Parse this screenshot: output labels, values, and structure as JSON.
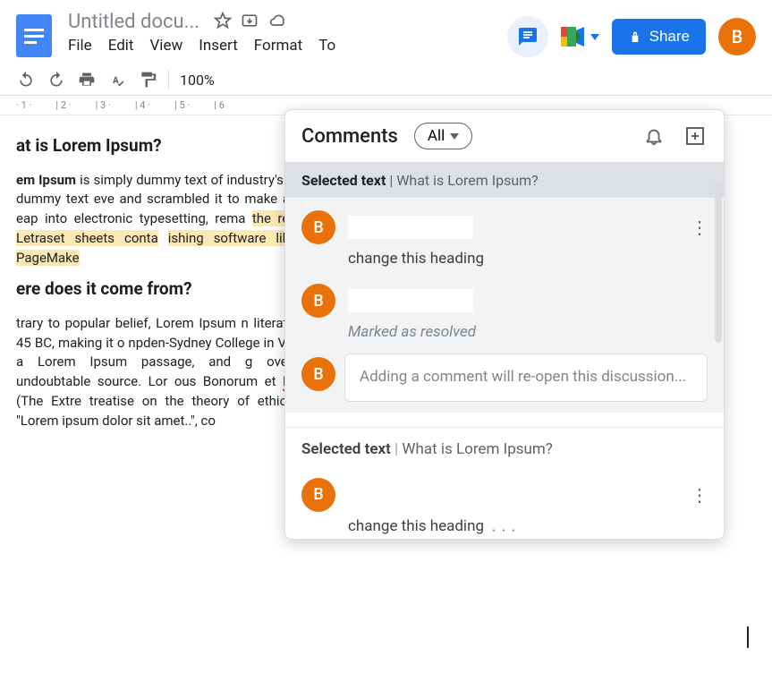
{
  "header": {
    "title": "Untitled docu...",
    "menus": [
      "File",
      "Edit",
      "View",
      "Insert",
      "Format",
      "To"
    ],
    "share_label": "Share",
    "avatar_initial": "B"
  },
  "toolbar": {
    "zoom": "100%"
  },
  "ruler": [
    "1",
    "2",
    "3",
    "4",
    "5",
    "6"
  ],
  "document": {
    "heading1": "at is Lorem Ipsum?",
    "p1_frag1": "em Ipsum",
    "p1_frag2": " is simply dummy text of industry's standard dummy text eve and scrambled it to make a type sp eap into electronic typesetting, rema ",
    "p1_hl1": "the release of Letraset sheets conta",
    "p1_hl2": "ishing software like Aldus PageMake",
    "heading2": "ere does it come from?",
    "p2_a": "trary to popular belief, Lorem Ipsum n literature from 45 BC, making it o npden-Sydney College in Virginia, lo  a Lorem Ipsum passage, and g overed the undoubtable source. Lor ous Bonorum et ",
    "p2_wavy": "Malorum",
    "p2_b": "\" (The Extre treatise on the theory of ethics, ve m, \"Lorem ipsum dolor sit amet..\", co"
  },
  "comments_panel": {
    "title": "Comments",
    "filter": "All",
    "threads": [
      {
        "selected_label": "Selected text",
        "selected_text": "What is Lorem Ipsum?",
        "entries": [
          {
            "avatar": "B",
            "text": "change this heading",
            "type": "comment"
          },
          {
            "avatar": "B",
            "text": "Marked as resolved",
            "type": "status"
          }
        ],
        "reply_placeholder": "Adding a comment will re-open this discussion...",
        "reply_avatar": "B"
      },
      {
        "selected_label": "Selected text",
        "selected_text": "What is Lorem Ipsum?",
        "entries": [
          {
            "avatar": "B",
            "text": "change this heading",
            "type": "comment"
          }
        ]
      }
    ]
  }
}
